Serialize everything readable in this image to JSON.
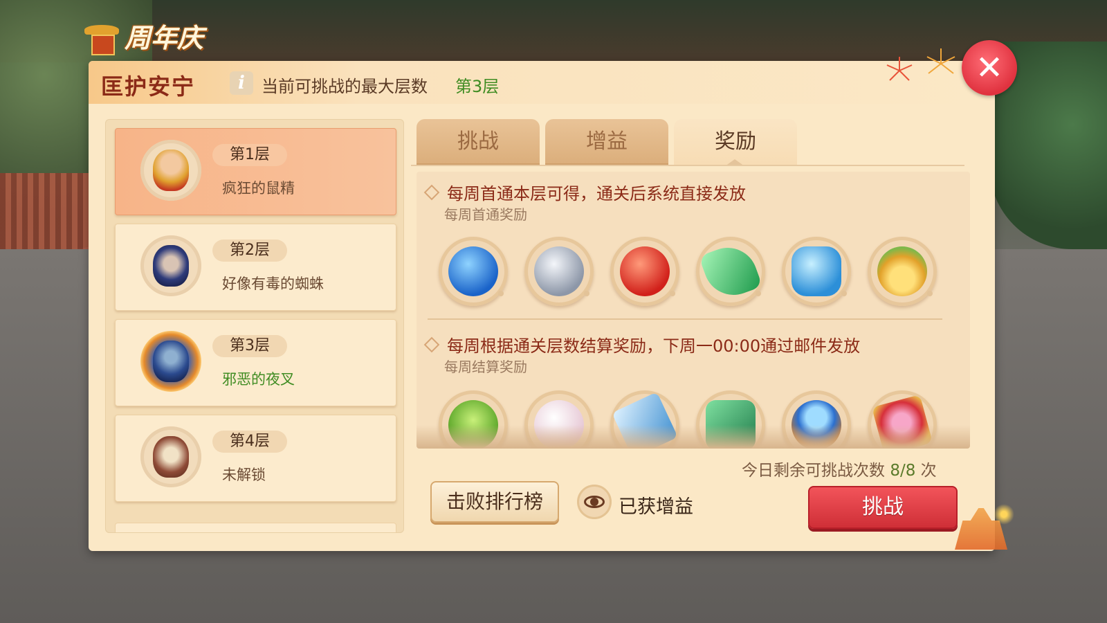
{
  "anniversary": {
    "text": "周年庆"
  },
  "header": {
    "title": "匡护安宁",
    "max_label": "当前可挑战的最大层数",
    "max_value": "第3层"
  },
  "levels": [
    {
      "tag": "第1层",
      "name": "疯狂的鼠精",
      "state": "selected"
    },
    {
      "tag": "第2层",
      "name": "好像有毒的蜘蛛",
      "state": "cleared"
    },
    {
      "tag": "第3层",
      "name": "邪恶的夜叉",
      "state": "current"
    },
    {
      "tag": "第4层",
      "name": "未解锁",
      "state": "locked"
    }
  ],
  "tabs": [
    {
      "label": "挑战",
      "active": false
    },
    {
      "label": "增益",
      "active": false
    },
    {
      "label": "奖励",
      "active": true
    }
  ],
  "rewards": {
    "first_clear": {
      "title": "每周首通本层可得，通关后系统直接发放",
      "subtitle": "每周首通奖励",
      "items": [
        "blue-orb-icon",
        "silver-coin-icon",
        "red-orb-icon",
        "green-crystal-icon",
        "blue-gem-icon",
        "golden-gourd-icon"
      ]
    },
    "weekly": {
      "title": "每周根据通关层数结算奖励，下周一00:00通过邮件发放",
      "subtitle": "每周结算奖励",
      "items": [
        "green-sprite-icon",
        "pearl-icon",
        "blue-scroll-icon",
        "green-scroll-icon",
        "crystal-ball-icon",
        "red-card-icon"
      ]
    }
  },
  "attempts": {
    "label": "今日剩余可挑战次数",
    "value": "8/8",
    "unit": "次"
  },
  "buttons": {
    "rank": "击败排行榜",
    "buff_status": "已获增益",
    "challenge": "挑战",
    "close": "✕"
  },
  "colors": {
    "accent_red": "#e0323f",
    "title_red": "#8b2a17",
    "current_green": "#3f8c22",
    "panel_bg": "#fbe8c6"
  }
}
